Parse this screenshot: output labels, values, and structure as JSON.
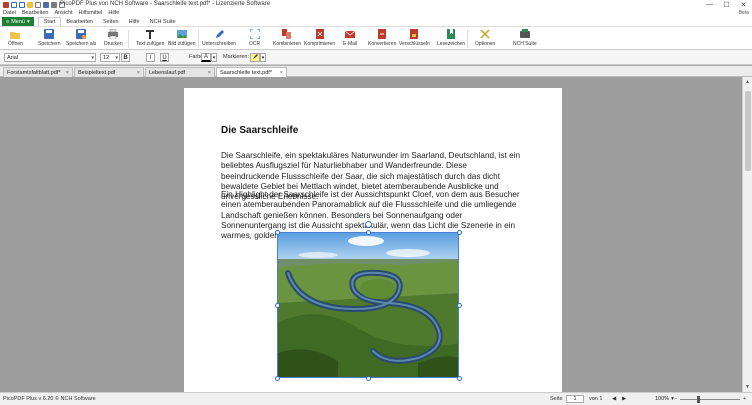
{
  "window": {
    "title": "PicoPDF Plus von NCH Software - Saarschleife text.pdf* - Lizenzierte Software",
    "minimize": "—",
    "maximize": "☐",
    "close": "✕"
  },
  "menubar": {
    "items": [
      "Datei",
      "Bearbeiten",
      "Ansicht",
      "Hilfsmittel",
      "Hilfe"
    ],
    "beta": "Beta"
  },
  "ribbon_tabs": {
    "menu_button": "Menü",
    "tabs": [
      "Start",
      "Bearbeiten",
      "Seiten",
      "Hilfe",
      "NCH Suite"
    ]
  },
  "ribbon": {
    "buttons": [
      "Öffnen",
      "Speichern",
      "Speichern als",
      "Drucken",
      "Text zufügen",
      "Bild zufügen",
      "Unterschreiben",
      "OCR",
      "Kombinieren",
      "Komprimieren",
      "E-Mail",
      "Konvertieren",
      "Verschlüsseln",
      "Lesezeichen",
      "Optionen",
      "NCH Suite"
    ]
  },
  "formatbar": {
    "font": "Arial",
    "size": "12",
    "bold": "B",
    "italic": "I",
    "underline": "U",
    "color_label": "Farbe:",
    "color_glyph": "A",
    "highlight_label": "Markieren:"
  },
  "doc_tabs": [
    {
      "label": "Forstamtsfaltblatt.pdf*"
    },
    {
      "label": "Beispieltext.pdf"
    },
    {
      "label": "Lebenslauf.pdf"
    },
    {
      "label": "Saarschleife text.pdf*"
    }
  ],
  "document": {
    "heading": "Die Saarschleife",
    "paragraph1": "Die Saarschleife, ein spektakuläres Naturwunder im Saarland, Deutschland, ist ein beliebtes Ausflugsziel für Naturliebhaber und Wanderfreunde. Diese beeindruckende Flussschleife der Saar, die sich majestätisch durch das dicht bewaldete Gebiet bei Mettlach windet, bietet atemberaubende Ausblicke und unvergessliche Erlebnisse.",
    "paragraph2": "Ein Highlight der Saarschleife ist der Aussichtspunkt Cloef, von dem aus Besucher einen atemberaubenden Panoramablick auf die Flussschleife und die umliegende Landschaft genießen können. Besonders bei Sonnenaufgang oder Sonnenuntergang ist die Aussicht spektakulär, wenn das Licht die Szenerie in ein warmes, goldenes Glühen taucht."
  },
  "statusbar": {
    "left": "PicoPDF Plus v 6.20 © NCH Software",
    "page_label": "Seite",
    "page_value": "1",
    "of_label": "von 1",
    "zoom": "100%",
    "zoom_level_percent": 30
  },
  "colors": {
    "menu_green": "#1e7e34",
    "selection_blue": "#2b6de0"
  }
}
